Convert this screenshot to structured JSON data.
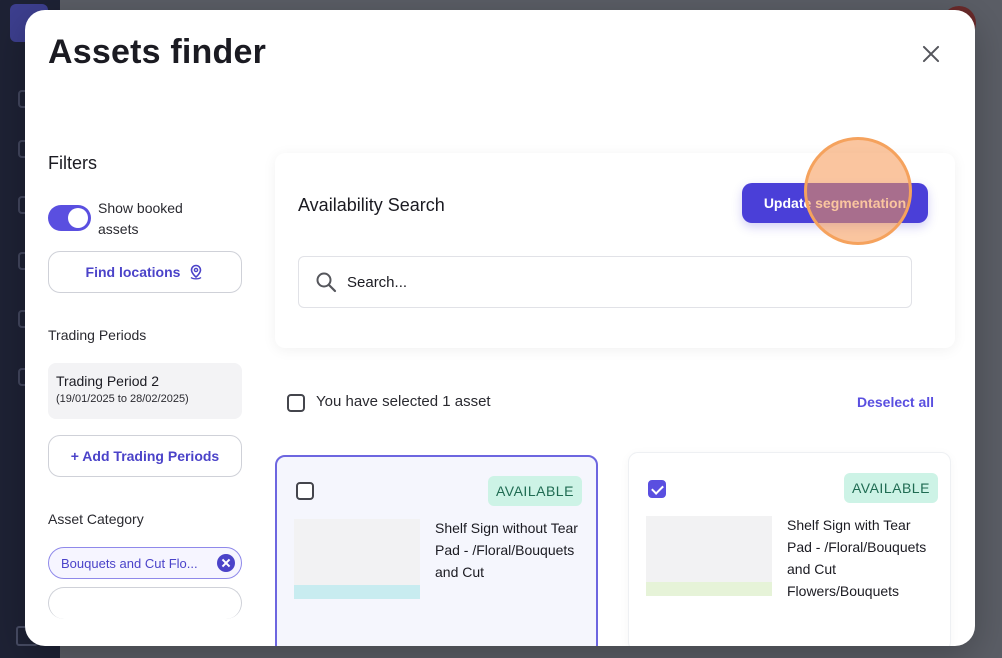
{
  "modal": {
    "title": "Assets finder",
    "close_label": "×"
  },
  "filters": {
    "title": "Filters",
    "show_booked_label": "Show booked assets",
    "show_booked_on": true,
    "find_locations_label": "Find locations",
    "trading_periods_label": "Trading Periods",
    "trading_period": {
      "name": "Trading Period 2",
      "dates": "(19/01/2025 to 28/02/2025)"
    },
    "add_trading_periods_label": "+ Add Trading Periods",
    "asset_category_label": "Asset Category",
    "asset_category_chip": "Bouquets and Cut Flo..."
  },
  "availability": {
    "title": "Availability Search",
    "update_button_label": "Update segmentation",
    "search_placeholder": "Search..."
  },
  "selection": {
    "summary": "You have selected 1 asset",
    "deselect_all_label": "Deselect all"
  },
  "assets": [
    {
      "status": "AVAILABLE",
      "title": "Shelf Sign without Tear Pad - /Floral/Bouquets and Cut",
      "checked": false,
      "accent_color": "#c8ecf0"
    },
    {
      "status": "AVAILABLE",
      "title": "Shelf Sign with Tear Pad - /Floral/Bouquets and Cut Flowers/Bouquets",
      "checked": true,
      "accent_color": "#e6f3d8"
    }
  ],
  "colors": {
    "primary": "#4a3fd8",
    "available_bg": "#cdf3e6",
    "highlight": "#f5a25d"
  }
}
